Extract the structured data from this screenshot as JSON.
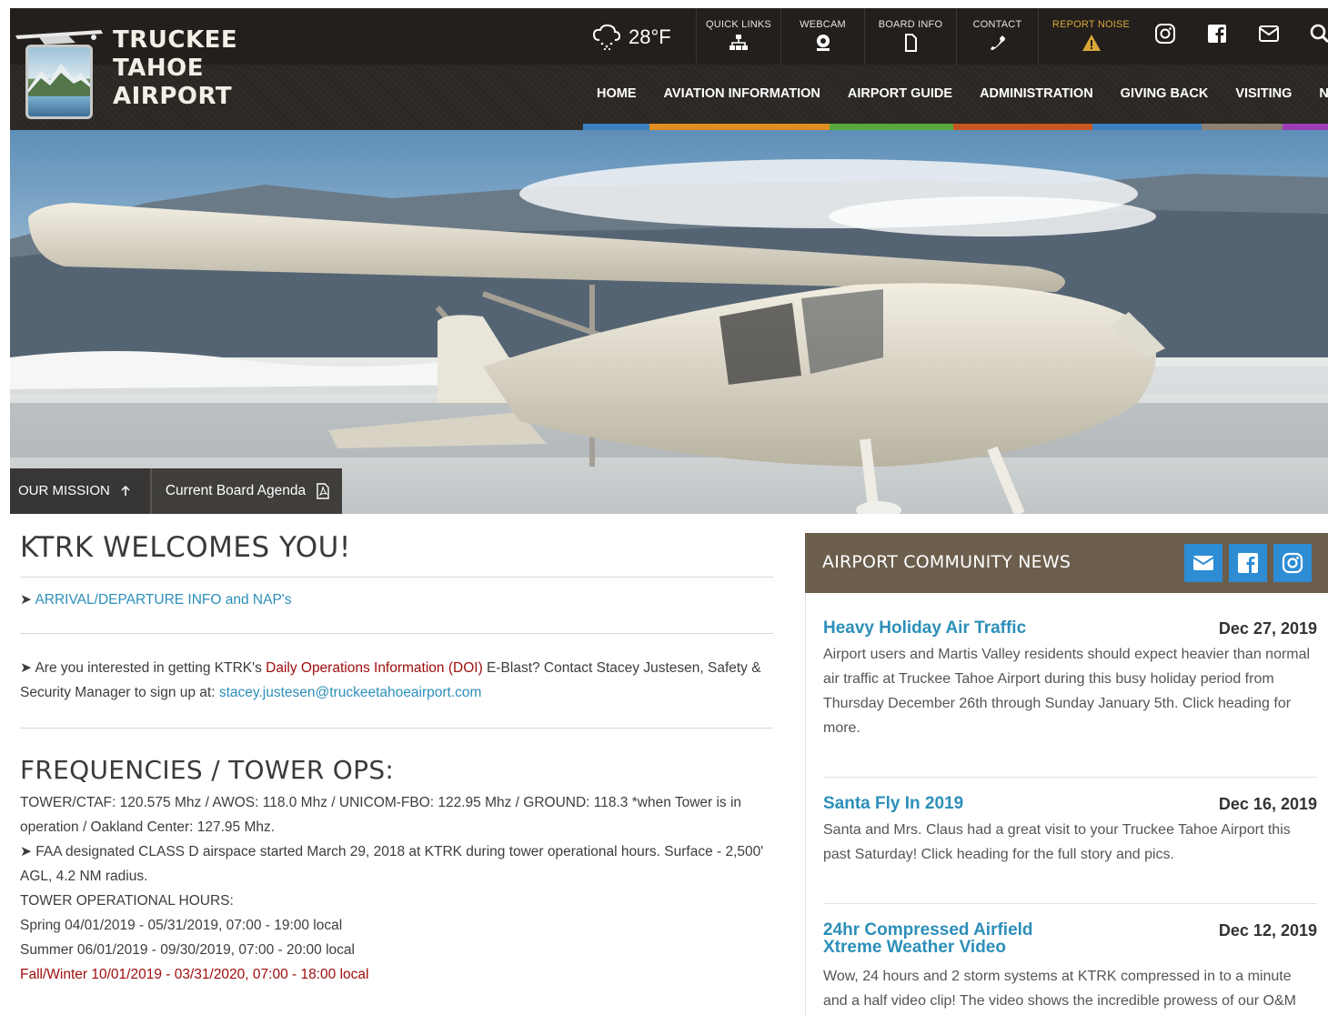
{
  "header": {
    "logo_lines": [
      "TRUCKEE",
      "TAHOE",
      "AIRPORT"
    ],
    "weather": {
      "temp": "28°F",
      "icon": "snow-cloud-icon"
    },
    "quick_links": [
      {
        "label": "QUICK LINKS",
        "icon": "sitemap-icon"
      },
      {
        "label": "WEBCAM",
        "icon": "webcam-icon"
      },
      {
        "label": "BOARD INFO",
        "icon": "document-icon"
      },
      {
        "label": "CONTACT",
        "icon": "phone-icon"
      },
      {
        "label": "REPORT NOISE",
        "icon": "warning-icon"
      }
    ],
    "social_icons": [
      "instagram-icon",
      "facebook-icon",
      "email-icon",
      "search-icon"
    ],
    "nav": [
      "HOME",
      "AVIATION INFORMATION",
      "AIRPORT GUIDE",
      "ADMINISTRATION",
      "GIVING BACK",
      "VISITING",
      "NEWS"
    ],
    "nav_colors": [
      "#3d7fc1",
      "#e08d22",
      "#59a83b",
      "#c85621",
      "#3d7fc1",
      "#8c8173",
      "#9c3fb6"
    ],
    "accent": "#d9a73a"
  },
  "hero": {
    "tabs": [
      {
        "label": "OUR MISSION",
        "icon": "arrow-up-icon"
      },
      {
        "label": "Current Board Agenda",
        "icon": "pdf-icon"
      }
    ]
  },
  "main": {
    "title": "KTRK WELCOMES YOU!",
    "arrival_link": "ARRIVAL/DEPARTURE INFO and NAP's",
    "doi": {
      "pre": "Are you interested in getting KTRK's ",
      "highlight": "Daily Operations Information (DOI)",
      "post": " E-Blast?  Contact Stacey Justesen, Safety & Security Manager to sign up at: ",
      "email": "stacey.justesen@truckeetahoeairport.com"
    },
    "freq_title": "FREQUENCIES / TOWER OPS:",
    "freq_lines": [
      "TOWER/CTAF: 120.575 Mhz / AWOS: 118.0 Mhz / UNICOM-FBO: 122.95 Mhz / GROUND: 118.3 *when Tower is in operation / Oakland Center: 127.95 Mhz.",
      "FAA designated CLASS D airspace started March 29, 2018 at KTRK during tower operational hours.  Surface - 2,500' AGL, 4.2 NM radius.",
      "TOWER OPERATIONAL HOURS:",
      "Spring 04/01/2019 - 05/31/2019,  07:00 - 19:00 local",
      "Summer 06/01/2019 - 09/30/2019,  07:00 - 20:00 local",
      "Fall/Winter 10/01/2019 - 03/31/2020,  07:00 - 18:00 local"
    ]
  },
  "sidebar": {
    "title": "AIRPORT COMMUNITY NEWS",
    "buttons": [
      "email-icon",
      "facebook-icon",
      "instagram-icon"
    ],
    "button_color": "#2d8cd4",
    "news": [
      {
        "title": "Heavy Holiday Air Traffic",
        "date": "Dec 27, 2019",
        "text": "Airport users and Martis Valley residents should expect heavier than normal air traffic at Truckee Tahoe Airport during this busy holiday period from Thursday December 26th through Sunday January 5th.  Click heading for more."
      },
      {
        "title": "Santa Fly In 2019",
        "date": "Dec 16, 2019",
        "text": "Santa and Mrs. Claus had a great visit to your Truckee Tahoe Airport this past Saturday! Click heading for the full story and pics."
      },
      {
        "title": "24hr Compressed Airfield Xtreme Weather Video",
        "date": "Dec 12, 2019",
        "text": "Wow, 24 hours and 2 storm systems at KTRK compressed in to a minute and a half video clip!  The video shows the incredible prowess of our O&M"
      }
    ]
  }
}
